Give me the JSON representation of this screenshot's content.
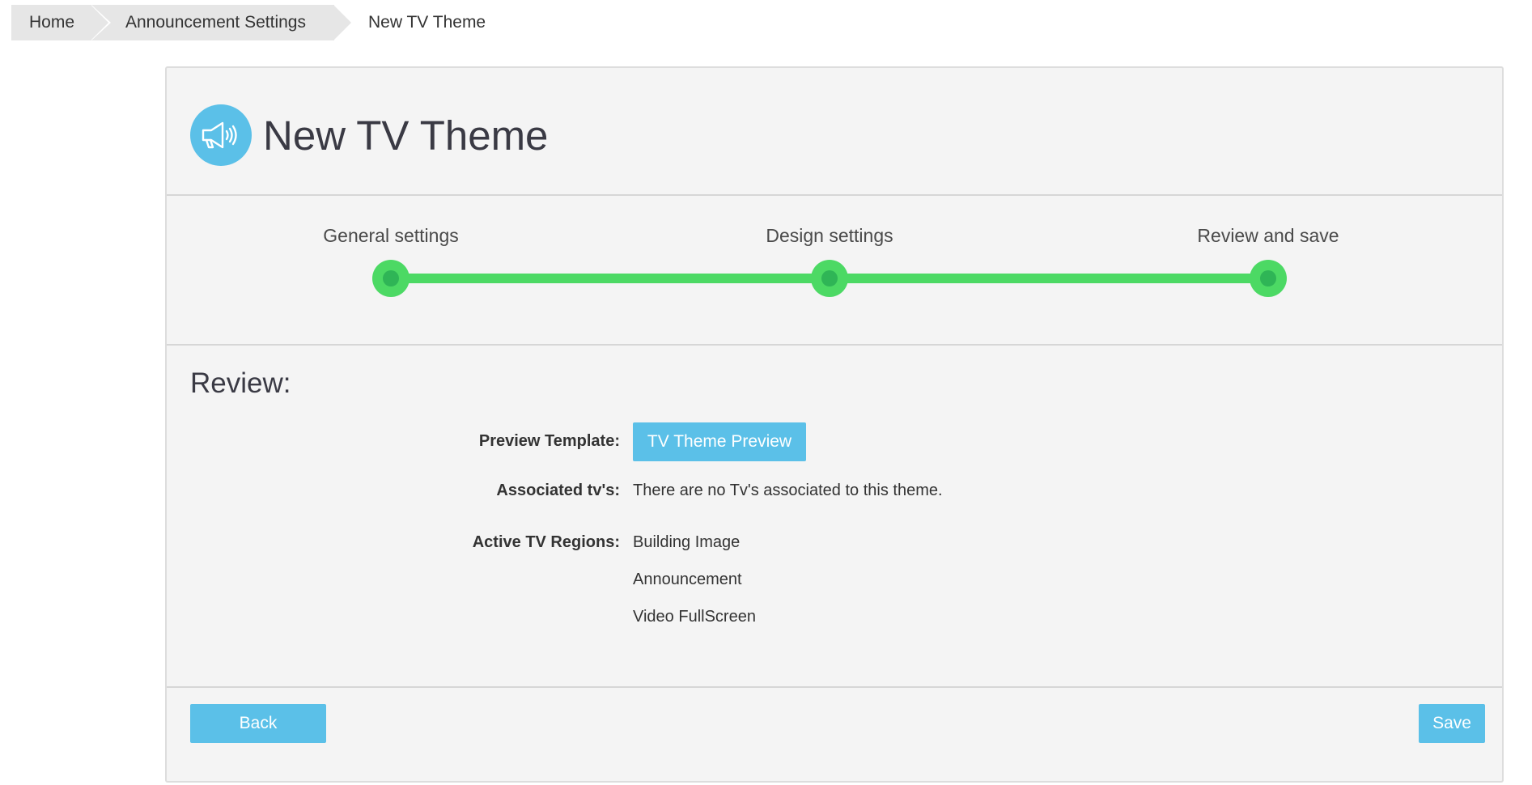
{
  "breadcrumb": {
    "home": "Home",
    "announcement_settings": "Announcement Settings",
    "current": "New TV Theme"
  },
  "header": {
    "title": "New TV Theme",
    "icon": "megaphone-icon"
  },
  "stepper": {
    "steps": [
      {
        "label": "General settings",
        "status": "complete"
      },
      {
        "label": "Design settings",
        "status": "complete"
      },
      {
        "label": "Review and save",
        "status": "active"
      }
    ],
    "colors": {
      "line": "#4cd964",
      "dot_inner": "#2fb556"
    }
  },
  "review": {
    "title": "Review:",
    "preview_template": {
      "label": "Preview Template:",
      "button_label": "TV Theme Preview"
    },
    "associated_tvs": {
      "label": "Associated tv's:",
      "value": "There are no Tv's associated to this theme."
    },
    "active_regions": {
      "label": "Active TV Regions:",
      "items": [
        "Building Image",
        "Announcement",
        "Video FullScreen"
      ]
    }
  },
  "footer": {
    "back_label": "Back",
    "save_label": "Save"
  },
  "colors": {
    "accent": "#5bc0e8",
    "panel_bg": "#f4f4f4",
    "breadcrumb_bg": "#e6e6e6"
  }
}
